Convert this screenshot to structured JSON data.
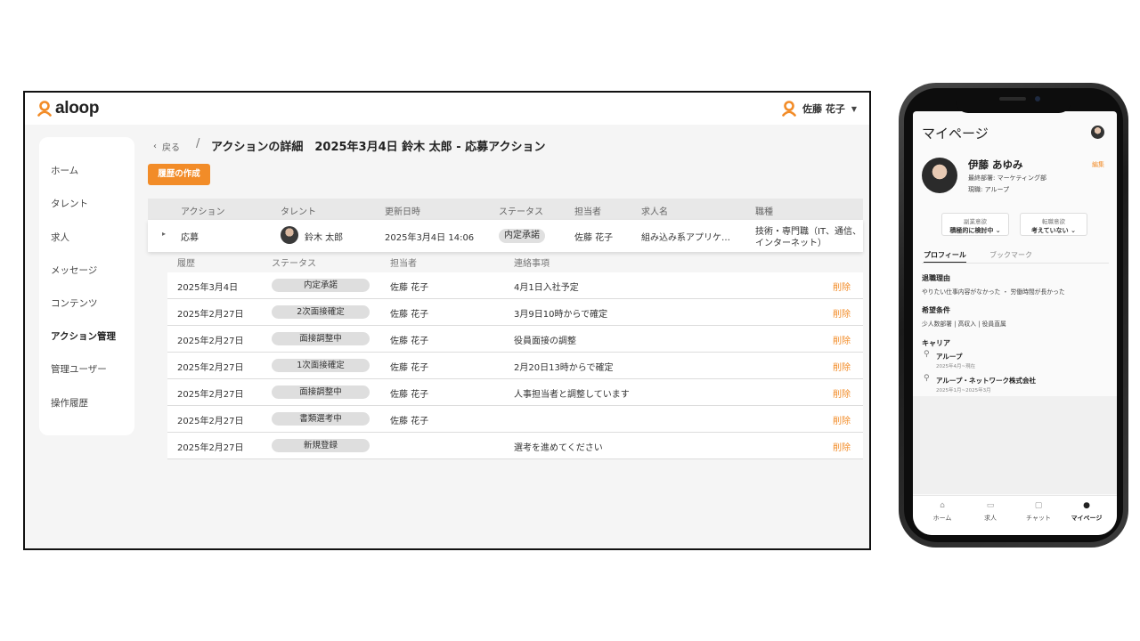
{
  "app": {
    "logo_text": "aloop",
    "user_name": "佐藤 花子"
  },
  "sidebar": {
    "items": [
      {
        "label": "ホーム"
      },
      {
        "label": "タレント"
      },
      {
        "label": "求人"
      },
      {
        "label": "メッセージ"
      },
      {
        "label": "コンテンツ"
      },
      {
        "label": "アクション管理"
      },
      {
        "label": "管理ユーザー"
      },
      {
        "label": "操作履歴"
      }
    ],
    "active_index": 5
  },
  "breadcrumb": {
    "back_label": "戻る",
    "separator": "/",
    "title": "アクションの詳細　2025年3月4日 鈴木 太郎 - 応募アクション"
  },
  "toolbar": {
    "create_label": "履歴の作成"
  },
  "table": {
    "headers": [
      "アクション",
      "タレント",
      "更新日時",
      "ステータス",
      "担当者",
      "求人名",
      "職種"
    ],
    "row": {
      "action": "応募",
      "talent": "鈴木 太郎",
      "updated": "2025年3月4日 14:06",
      "status": "内定承諾",
      "assignee": "佐藤 花子",
      "job": "組み込み系アプリケ…",
      "category_line1": "技術・専門職（IT、通信、",
      "category_line2": "インターネット）"
    }
  },
  "history": {
    "headers": [
      "履歴",
      "ステータス",
      "担当者",
      "連絡事項"
    ],
    "delete_label": "削除",
    "rows": [
      {
        "date": "2025年3月4日",
        "status": "内定承諾",
        "assignee": "佐藤 花子",
        "note": "4月1日入社予定"
      },
      {
        "date": "2025年2月27日",
        "status": "2次面接確定",
        "assignee": "佐藤 花子",
        "note": "3月9日10時からで確定"
      },
      {
        "date": "2025年2月27日",
        "status": "面接調整中",
        "assignee": "佐藤 花子",
        "note": "役員面接の調整"
      },
      {
        "date": "2025年2月27日",
        "status": "1次面接確定",
        "assignee": "佐藤 花子",
        "note": "2月20日13時からで確定"
      },
      {
        "date": "2025年2月27日",
        "status": "面接調整中",
        "assignee": "佐藤 花子",
        "note": "人事担当者と調整しています"
      },
      {
        "date": "2025年2月27日",
        "status": "書類選考中",
        "assignee": "佐藤 花子",
        "note": ""
      },
      {
        "date": "2025年2月27日",
        "status": "新規登録",
        "assignee": "",
        "note": "選考を進めてください"
      }
    ]
  },
  "colors": {
    "accent": "#f28c28",
    "sidebar_bg": "#ffffff",
    "page_bg": "#f5f5f5"
  },
  "mobile": {
    "title": "マイページ",
    "profile": {
      "name": "伊藤 あゆみ",
      "edit_label": "編集",
      "dept_line": "最終部署: マーケティング部",
      "current_line": "現職: アループ"
    },
    "side_job": {
      "label": "副業意欲",
      "value": "積極的に検討中"
    },
    "job_change": {
      "label": "転職意欲",
      "value": "考えていない"
    },
    "tabs": [
      {
        "label": "プロフィール"
      },
      {
        "label": "ブックマーク"
      }
    ],
    "reason": {
      "heading": "退職理由",
      "text": "やりたい仕事内容がなかった ・ 労働時間が長かった"
    },
    "conditions": {
      "heading": "希望条件",
      "text": "少人数部署 | 高収入 | 役員直属"
    },
    "career": {
      "heading": "キャリア",
      "items": [
        {
          "company": "アループ",
          "period": "2025年4月~現在"
        },
        {
          "company": "アループ・ネットワーク株式会社",
          "period": "2025年1月~2025年3月"
        }
      ]
    },
    "nav": [
      {
        "label": "ホーム",
        "icon": "home-icon"
      },
      {
        "label": "求人",
        "icon": "briefcase-icon"
      },
      {
        "label": "チャット",
        "icon": "chat-icon"
      },
      {
        "label": "マイページ",
        "icon": "person-icon"
      }
    ]
  }
}
